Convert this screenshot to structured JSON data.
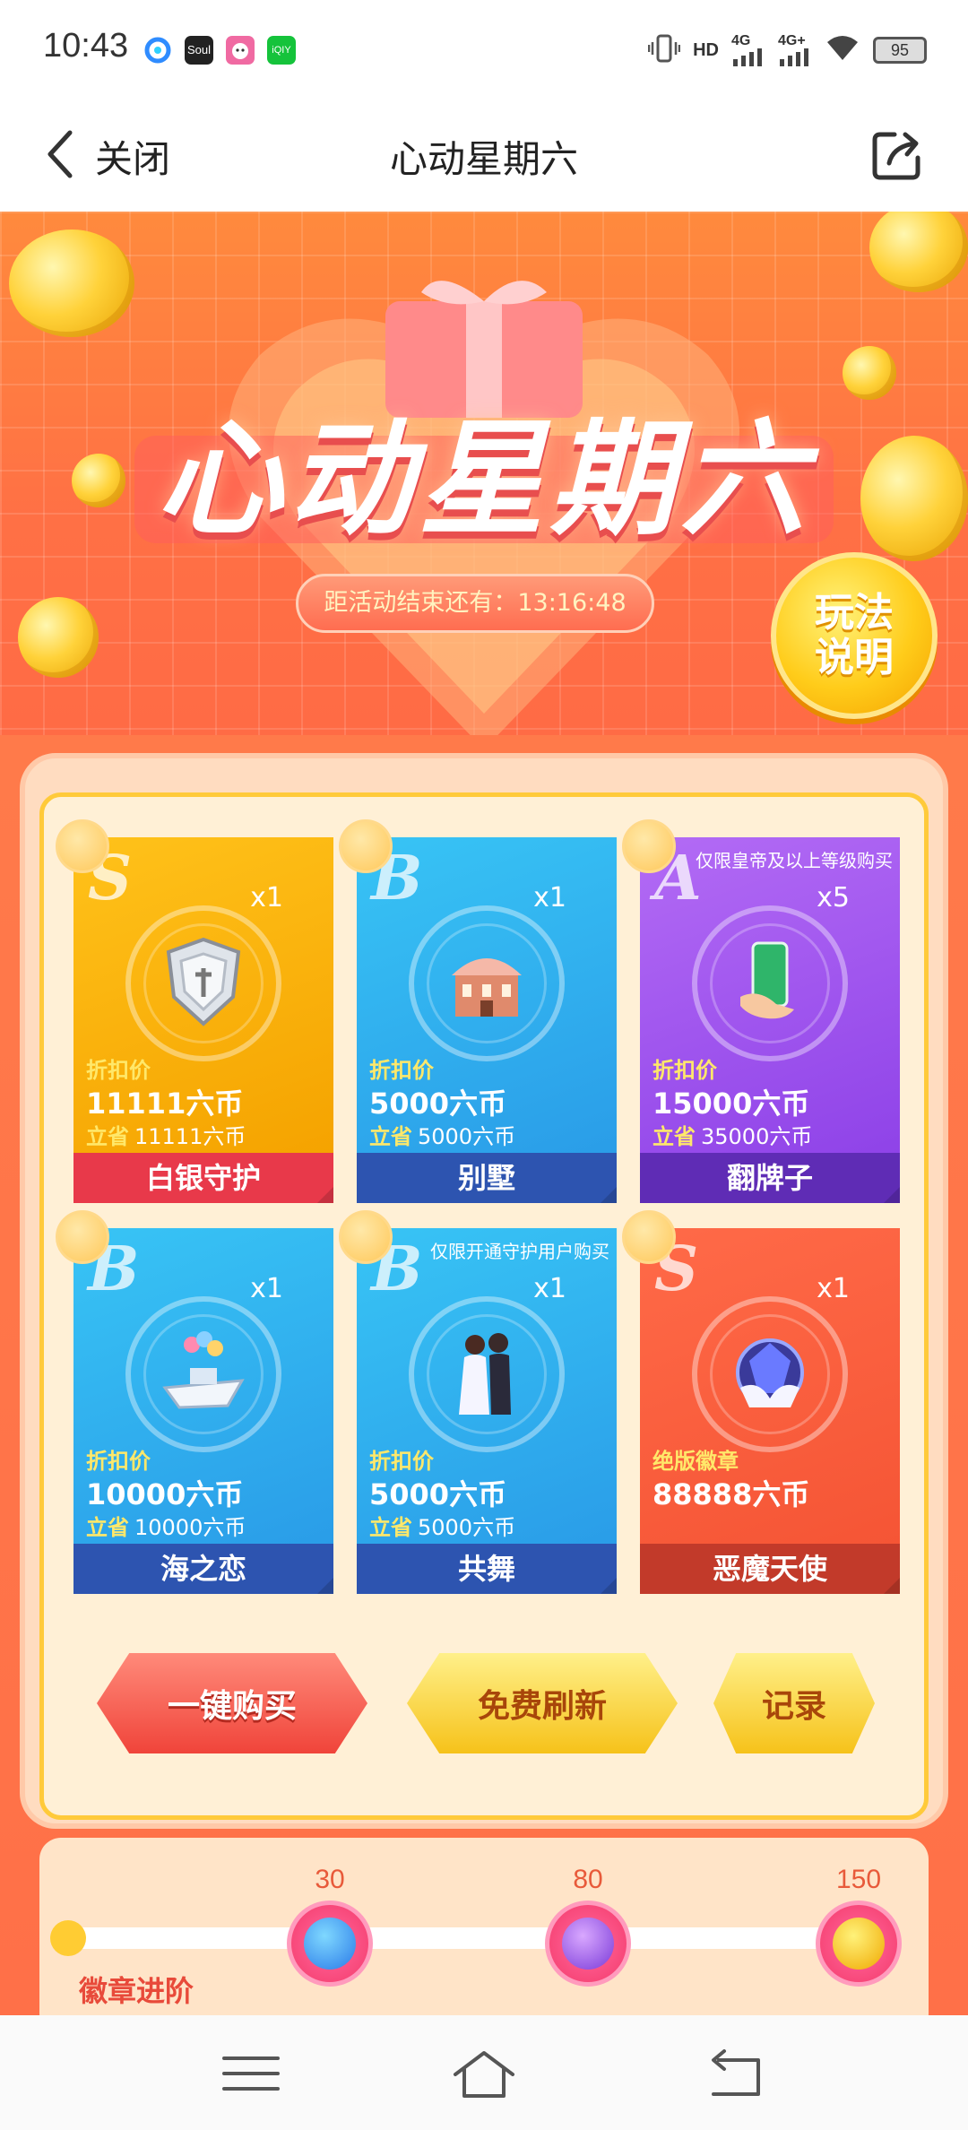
{
  "status_bar": {
    "time": "10:43",
    "apps": [
      {
        "name": "qq-browser-icon",
        "label": "",
        "color": "#2f8cff"
      },
      {
        "name": "soul-app-icon",
        "label": "Soul",
        "color": "#222222"
      },
      {
        "name": "pink-app-icon",
        "label": "",
        "color": "#f06aa2"
      },
      {
        "name": "iqiyi-app-icon",
        "label": "iQIY",
        "color": "#15c33b"
      }
    ],
    "hd_label": "HD",
    "net1": "4G",
    "net2": "4G+",
    "battery": "95"
  },
  "nav": {
    "close_label": "关闭",
    "title": "心动星期六"
  },
  "banner": {
    "title": "心动星期六",
    "countdown": "距活动结束还有：13:16:48",
    "rules_button": "玩法说明"
  },
  "cards": [
    {
      "grade": "S",
      "qty": "x1",
      "label1": "折扣价",
      "price": "11111六币",
      "save_label": "立省",
      "save_value": "11111六币",
      "note": "",
      "name": "白银守护",
      "theme": "gold",
      "icon": "silver-guard-shield-icon"
    },
    {
      "grade": "B",
      "qty": "x1",
      "label1": "折扣价",
      "price": "5000六币",
      "save_label": "立省",
      "save_value": "5000六币",
      "note": "",
      "name": "别墅",
      "theme": "blue",
      "icon": "villa-icon"
    },
    {
      "grade": "A",
      "qty": "x5",
      "label1": "折扣价",
      "price": "15000六币",
      "save_label": "立省",
      "save_value": "35000六币",
      "note": "仅限皇帝及以上等级购买",
      "name": "翻牌子",
      "theme": "purple",
      "icon": "tablet-card-icon"
    },
    {
      "grade": "B",
      "qty": "x1",
      "label1": "折扣价",
      "price": "10000六币",
      "save_label": "立省",
      "save_value": "10000六币",
      "note": "",
      "name": "海之恋",
      "theme": "blue",
      "icon": "yacht-icon"
    },
    {
      "grade": "B",
      "qty": "x1",
      "label1": "折扣价",
      "price": "5000六币",
      "save_label": "立省",
      "save_value": "5000六币",
      "note": "仅限开通守护用户购买",
      "name": "共舞",
      "theme": "blue",
      "icon": "dancing-couple-icon"
    },
    {
      "grade": "S",
      "qty": "x1",
      "label1": "绝版徽章",
      "price": "88888六币",
      "save_label": "",
      "save_value": "",
      "note": "",
      "name": "恶魔天使",
      "theme": "red",
      "icon": "demon-angel-badge-icon"
    }
  ],
  "actions": {
    "buy_all": "一键购买",
    "free_refresh": "免费刷新",
    "record": "记录"
  },
  "progress": {
    "label": "徽章进阶",
    "milestones": [
      {
        "value": "30",
        "icon": "blue-shield-badge-icon"
      },
      {
        "value": "80",
        "icon": "purple-sword-badge-icon"
      },
      {
        "value": "150",
        "icon": "gold-crown-badge-icon"
      }
    ]
  },
  "colors": {
    "accent_orange": "#ff7a4a",
    "gold": "#ffc21a",
    "card_blue": "#2a9de8",
    "card_purple": "#8f43e8",
    "card_red": "#f55535"
  }
}
